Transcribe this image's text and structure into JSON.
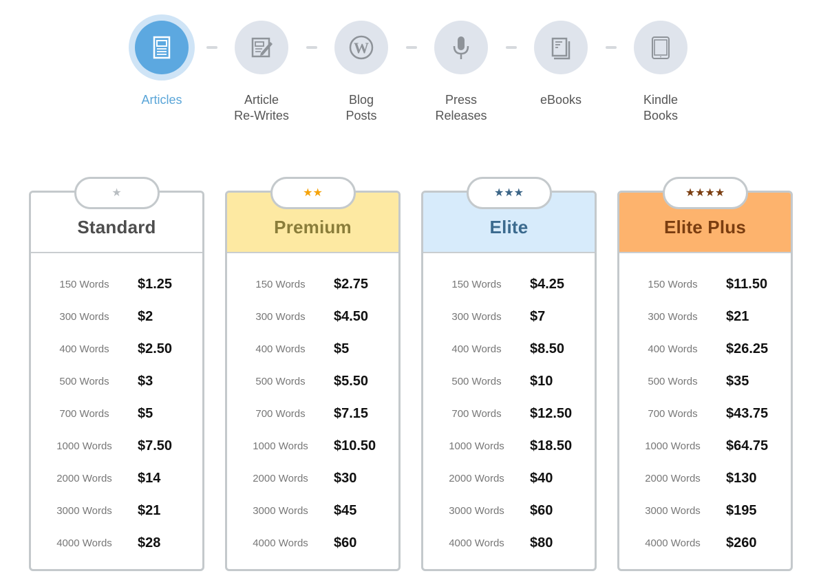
{
  "categories": [
    {
      "label": "Articles",
      "icon": "article-icon",
      "active": true
    },
    {
      "label": "Article\nRe-Writes",
      "icon": "edit-document-icon",
      "active": false
    },
    {
      "label": "Blog\nPosts",
      "icon": "wordpress-icon",
      "active": false
    },
    {
      "label": "Press\nReleases",
      "icon": "microphone-icon",
      "active": false
    },
    {
      "label": "eBooks",
      "icon": "book-icon",
      "active": false
    },
    {
      "label": "Kindle\nBooks",
      "icon": "tablet-icon",
      "active": false
    }
  ],
  "colors": {
    "active_accent": "#5ca8e0",
    "inactive_circle": "#dfe4ec",
    "standard_header": "#ffffff",
    "premium_header": "#fde9a2",
    "elite_header": "#d7ebfb",
    "elite_plus_header": "#fdb36d"
  },
  "plans": [
    {
      "name": "Standard",
      "stars": 1,
      "star_glyphs": "★",
      "rows": [
        {
          "words": "150 Words",
          "price": "$1.25"
        },
        {
          "words": "300 Words",
          "price": "$2"
        },
        {
          "words": "400 Words",
          "price": "$2.50"
        },
        {
          "words": "500 Words",
          "price": "$3"
        },
        {
          "words": "700 Words",
          "price": "$5"
        },
        {
          "words": "1000 Words",
          "price": "$7.50"
        },
        {
          "words": "2000 Words",
          "price": "$14"
        },
        {
          "words": "3000 Words",
          "price": "$21"
        },
        {
          "words": "4000 Words",
          "price": "$28"
        }
      ]
    },
    {
      "name": "Premium",
      "stars": 2,
      "star_glyphs": "★★",
      "rows": [
        {
          "words": "150 Words",
          "price": "$2.75"
        },
        {
          "words": "300 Words",
          "price": "$4.50"
        },
        {
          "words": "400 Words",
          "price": "$5"
        },
        {
          "words": "500 Words",
          "price": "$5.50"
        },
        {
          "words": "700 Words",
          "price": "$7.15"
        },
        {
          "words": "1000 Words",
          "price": "$10.50"
        },
        {
          "words": "2000 Words",
          "price": "$30"
        },
        {
          "words": "3000 Words",
          "price": "$45"
        },
        {
          "words": "4000 Words",
          "price": "$60"
        }
      ]
    },
    {
      "name": "Elite",
      "stars": 3,
      "star_glyphs": "★★★",
      "rows": [
        {
          "words": "150 Words",
          "price": "$4.25"
        },
        {
          "words": "300 Words",
          "price": "$7"
        },
        {
          "words": "400 Words",
          "price": "$8.50"
        },
        {
          "words": "500 Words",
          "price": "$10"
        },
        {
          "words": "700 Words",
          "price": "$12.50"
        },
        {
          "words": "1000 Words",
          "price": "$18.50"
        },
        {
          "words": "2000 Words",
          "price": "$40"
        },
        {
          "words": "3000 Words",
          "price": "$60"
        },
        {
          "words": "4000 Words",
          "price": "$80"
        }
      ]
    },
    {
      "name": "Elite Plus",
      "stars": 4,
      "star_glyphs": "★★★★",
      "rows": [
        {
          "words": "150 Words",
          "price": "$11.50"
        },
        {
          "words": "300 Words",
          "price": "$21"
        },
        {
          "words": "400 Words",
          "price": "$26.25"
        },
        {
          "words": "500 Words",
          "price": "$35"
        },
        {
          "words": "700 Words",
          "price": "$43.75"
        },
        {
          "words": "1000 Words",
          "price": "$64.75"
        },
        {
          "words": "2000 Words",
          "price": "$130"
        },
        {
          "words": "3000 Words",
          "price": "$195"
        },
        {
          "words": "4000 Words",
          "price": "$260"
        }
      ]
    }
  ]
}
